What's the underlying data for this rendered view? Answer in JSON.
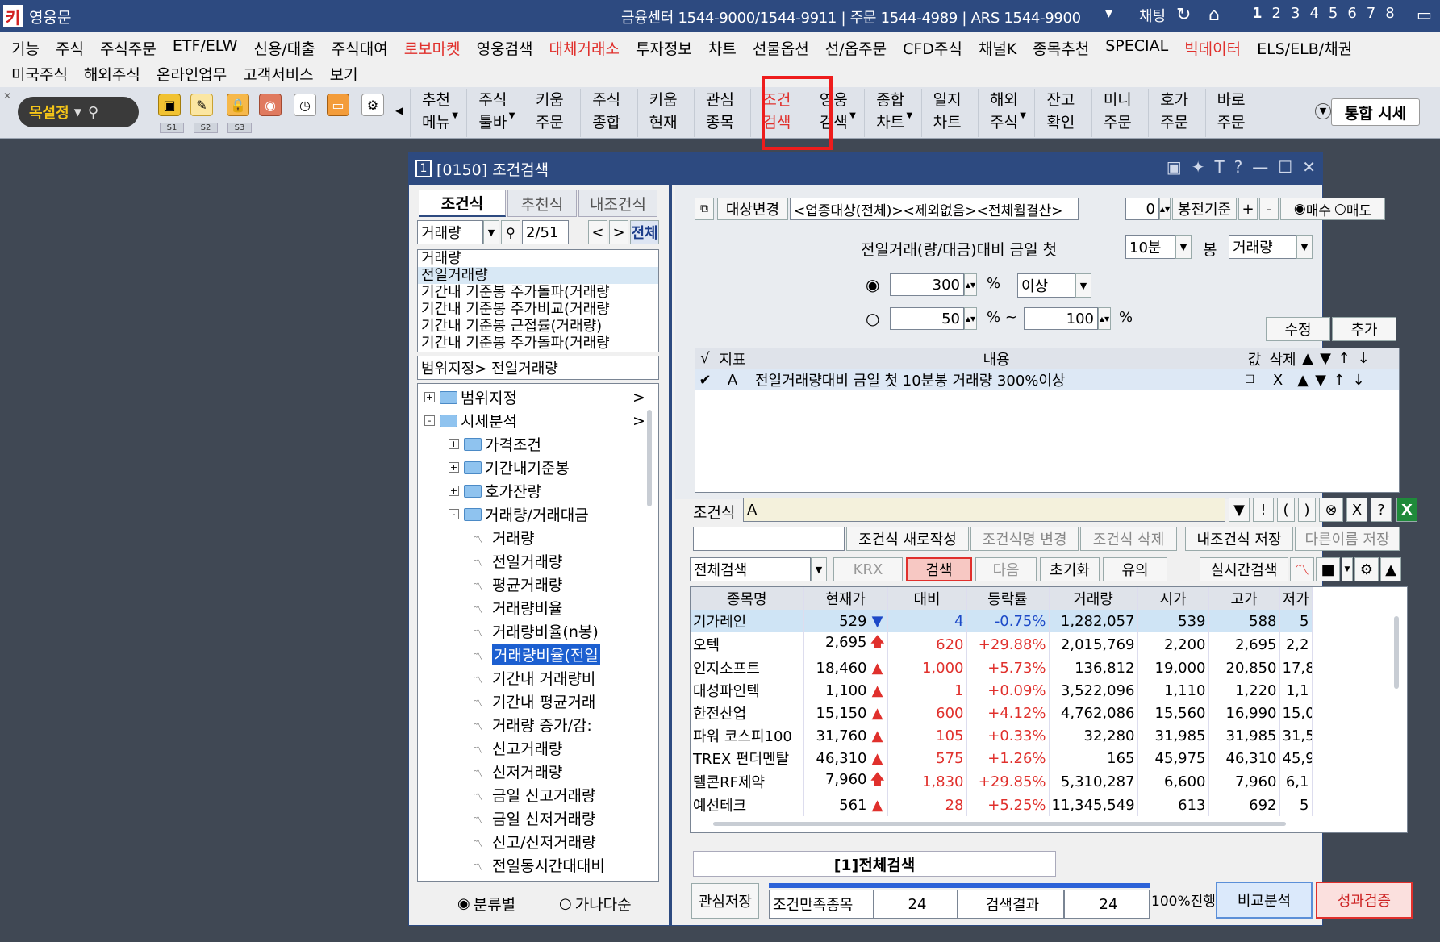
{
  "titlebar": {
    "app_title": "영웅문",
    "hotline": "금융센터 1544-9000/1544-9911 | 주문 1544-4989 | ARS 1544-9900",
    "chat": "채팅",
    "screen_numbers": [
      "1",
      "2",
      "3",
      "4",
      "5",
      "6",
      "7",
      "8"
    ]
  },
  "menu": {
    "row1": [
      {
        "label": "기능",
        "red": false
      },
      {
        "label": "주식",
        "red": false
      },
      {
        "label": "주식주문",
        "red": false
      },
      {
        "label": "ETF/ELW",
        "red": false
      },
      {
        "label": "신용/대출",
        "red": false
      },
      {
        "label": "주식대여",
        "red": false
      },
      {
        "label": "로보마켓",
        "red": true
      },
      {
        "label": "영웅검색",
        "red": false
      },
      {
        "label": "대체거래소",
        "red": true
      },
      {
        "label": "투자정보",
        "red": false
      },
      {
        "label": "차트",
        "red": false
      },
      {
        "label": "선물옵션",
        "red": false
      },
      {
        "label": "선/옵주문",
        "red": false
      },
      {
        "label": "CFD주식",
        "red": false
      },
      {
        "label": "채널K",
        "red": false
      },
      {
        "label": "종목추천",
        "red": false
      },
      {
        "label": "SPECIAL",
        "red": false
      },
      {
        "label": "빅데이터",
        "red": true
      },
      {
        "label": "ELS/ELB/채권",
        "red": false
      }
    ],
    "row2": [
      {
        "label": "미국주식",
        "red": false
      },
      {
        "label": "해외주식",
        "red": false
      },
      {
        "label": "온라인업무",
        "red": false
      },
      {
        "label": "고객서비스",
        "red": false
      },
      {
        "label": "보기",
        "red": false
      }
    ]
  },
  "toolbar": {
    "bookmark": "목설정",
    "s_labels": [
      "S1",
      "S2",
      "S3"
    ],
    "items": [
      {
        "top": "추천",
        "bottom": "메뉴",
        "arrow": true
      },
      {
        "top": "주식",
        "bottom": "툴바",
        "arrow": true
      },
      {
        "top": "키움",
        "bottom": "주문",
        "arrow": false
      },
      {
        "top": "주식",
        "bottom": "종합",
        "arrow": false
      },
      {
        "top": "키움",
        "bottom": "현재",
        "arrow": false
      },
      {
        "top": "관심",
        "bottom": "종목",
        "arrow": false
      },
      {
        "top": "조건",
        "bottom": "검색",
        "arrow": false,
        "highlight": true
      },
      {
        "top": "영웅",
        "bottom": "검색",
        "arrow": true
      },
      {
        "top": "종합",
        "bottom": "차트",
        "arrow": true
      },
      {
        "top": "일지",
        "bottom": "차트",
        "arrow": false
      },
      {
        "top": "해외",
        "bottom": "주식",
        "arrow": true
      },
      {
        "top": "잔고",
        "bottom": "확인",
        "arrow": false
      },
      {
        "top": "미니",
        "bottom": "주문",
        "arrow": false
      },
      {
        "top": "호가",
        "bottom": "주문",
        "arrow": false
      },
      {
        "top": "바로",
        "bottom": "주문",
        "arrow": false
      }
    ],
    "integrated": "통합 시세"
  },
  "window": {
    "title": "[0150] 조건검색",
    "left": {
      "tabs": [
        "조건식",
        "추천식",
        "내조건식"
      ],
      "search_value": "거래량",
      "counter": "2/51",
      "all_btn": "전체",
      "list": [
        "거래량",
        "전일거래량",
        "기간내 기준봉 주가돌파(거래량",
        "기간내 기준봉 주가비교(거래량",
        "기간내 기준봉 근접률(거래량)",
        "기간내 기준봉 주가돌파(거래량"
      ],
      "path": "범위지정> 전일거래량",
      "tree": [
        {
          "label": "범위지정",
          "level": 0,
          "type": "folder",
          "sign": "+",
          "arrow": ">"
        },
        {
          "label": "시세분석",
          "level": 0,
          "type": "folder",
          "sign": "-",
          "arrow": ">"
        },
        {
          "label": "가격조건",
          "level": 1,
          "type": "folder",
          "sign": "+"
        },
        {
          "label": "기간내기준봉",
          "level": 1,
          "type": "folder",
          "sign": "+"
        },
        {
          "label": "호가잔량",
          "level": 1,
          "type": "folder",
          "sign": "+"
        },
        {
          "label": "거래량/거래대금",
          "level": 1,
          "type": "folder",
          "sign": "-"
        },
        {
          "label": "거래량",
          "level": 2,
          "type": "item"
        },
        {
          "label": "전일거래량",
          "level": 2,
          "type": "item"
        },
        {
          "label": "평균거래량",
          "level": 2,
          "type": "item"
        },
        {
          "label": "거래량비율",
          "level": 2,
          "type": "item"
        },
        {
          "label": "거래량비율(n봉)",
          "level": 2,
          "type": "item"
        },
        {
          "label": "거래량비율(전일",
          "level": 2,
          "type": "item",
          "selected": true
        },
        {
          "label": "기간내 거래량비",
          "level": 2,
          "type": "item"
        },
        {
          "label": "기간내 평균거래",
          "level": 2,
          "type": "item"
        },
        {
          "label": "거래량 증가/감:",
          "level": 2,
          "type": "item"
        },
        {
          "label": "신고거래량",
          "level": 2,
          "type": "item"
        },
        {
          "label": "신저거래량",
          "level": 2,
          "type": "item"
        },
        {
          "label": "금일 신고거래량",
          "level": 2,
          "type": "item"
        },
        {
          "label": "금일 신저거래량",
          "level": 2,
          "type": "item"
        },
        {
          "label": "신고/신저거래량",
          "level": 2,
          "type": "item"
        },
        {
          "label": "전일동시간대대비",
          "level": 2,
          "type": "item"
        }
      ],
      "sort_category": "분류별",
      "sort_alpha": "가나다순"
    },
    "right": {
      "target_btn": "대상변경",
      "target_text": "<업종대상(전체)><제외없음><전체월결산>",
      "bong_value": "0",
      "bong_label": "봉전기준",
      "buy": "매수",
      "sell": "매도",
      "cond_label": "전일거래(량/대금)대비 금일 첫",
      "period": "10분",
      "bong": "봉",
      "kind": "거래량",
      "val1": "300",
      "pct": "%",
      "above": "이상",
      "val2": "50",
      "tilde": "% ~",
      "val3": "100",
      "modify": "수정",
      "add": "추가",
      "cond_headers": [
        "√",
        "지표",
        "내용",
        "값",
        "삭제",
        "▲",
        "▼",
        "↑",
        "↓"
      ],
      "cond_row": {
        "check": "✔",
        "id": "A",
        "text": "전일거래량대비 금일 첫 10분봉 거래량 300%이상",
        "del": "X",
        "up": "▲",
        "down": "▼",
        "top": "↑",
        "bottom": "↓"
      },
      "formula_label": "조건식",
      "formula": "A",
      "formula_btns": [
        "▼",
        "!",
        "(",
        ")",
        "⊗",
        "X",
        "?"
      ],
      "new_btn": "조건식 새로작성",
      "rename_btn": "조건식명 변경",
      "delete_btn": "조건식 삭제",
      "save_btn": "내조건식 저장",
      "save_as_btn": "다른이름 저장",
      "scope": "전체검색",
      "krx": "KRX",
      "search": "검색",
      "next": "다음",
      "reset": "초기화",
      "notice": "유의",
      "realtime": "실시간검색",
      "headers": [
        "종목명",
        "현재가",
        "대비",
        "등락률",
        "거래량",
        "시가",
        "고가",
        "저가"
      ],
      "rows": [
        {
          "name": "기가레인",
          "price": "529",
          "sign": "▼",
          "chg": "4",
          "rate": "-0.75%",
          "vol": "1,282,057",
          "open": "539",
          "high": "588",
          "low": "5",
          "dir": "down",
          "selected": true
        },
        {
          "name": "오텍",
          "price": "2,695",
          "sign": "🡅",
          "chg": "620",
          "rate": "+29.88%",
          "vol": "2,015,769",
          "open": "2,200",
          "high": "2,695",
          "low": "2,2",
          "dir": "limit"
        },
        {
          "name": "인지소프트",
          "price": "18,460",
          "sign": "▲",
          "chg": "1,000",
          "rate": "+5.73%",
          "vol": "136,812",
          "open": "19,000",
          "high": "20,850",
          "low": "17,8",
          "dir": "up"
        },
        {
          "name": "대성파인텍",
          "price": "1,100",
          "sign": "▲",
          "chg": "1",
          "rate": "+0.09%",
          "vol": "3,522,096",
          "open": "1,110",
          "high": "1,220",
          "low": "1,1",
          "dir": "up"
        },
        {
          "name": "한전산업",
          "price": "15,150",
          "sign": "▲",
          "chg": "600",
          "rate": "+4.12%",
          "vol": "4,762,086",
          "open": "15,560",
          "high": "16,990",
          "low": "15,0",
          "dir": "up"
        },
        {
          "name": "파워 코스피100",
          "price": "31,760",
          "sign": "▲",
          "chg": "105",
          "rate": "+0.33%",
          "vol": "32,280",
          "open": "31,985",
          "high": "31,985",
          "low": "31,5",
          "dir": "up"
        },
        {
          "name": "TREX 펀더멘탈",
          "price": "46,310",
          "sign": "▲",
          "chg": "575",
          "rate": "+1.26%",
          "vol": "165",
          "open": "45,975",
          "high": "46,310",
          "low": "45,9",
          "dir": "up"
        },
        {
          "name": "텔콘RF제약",
          "price": "7,960",
          "sign": "🡅",
          "chg": "1,830",
          "rate": "+29.85%",
          "vol": "5,310,287",
          "open": "6,600",
          "high": "7,960",
          "low": "6,1",
          "dir": "limit"
        },
        {
          "name": "예선테크",
          "price": "561",
          "sign": "▲",
          "chg": "28",
          "rate": "+5.25%",
          "vol": "11,345,549",
          "open": "613",
          "high": "692",
          "low": "5",
          "dir": "up"
        }
      ],
      "result_tab": "[1]전체검색",
      "fav_save": "관심저장",
      "match_label": "조건만족종목",
      "match_count": "24",
      "result_label": "검색결과",
      "result_count": "24",
      "progress_text": "100%진행",
      "progress": 1.0,
      "compare": "비교분석",
      "verify": "성과검증"
    }
  }
}
